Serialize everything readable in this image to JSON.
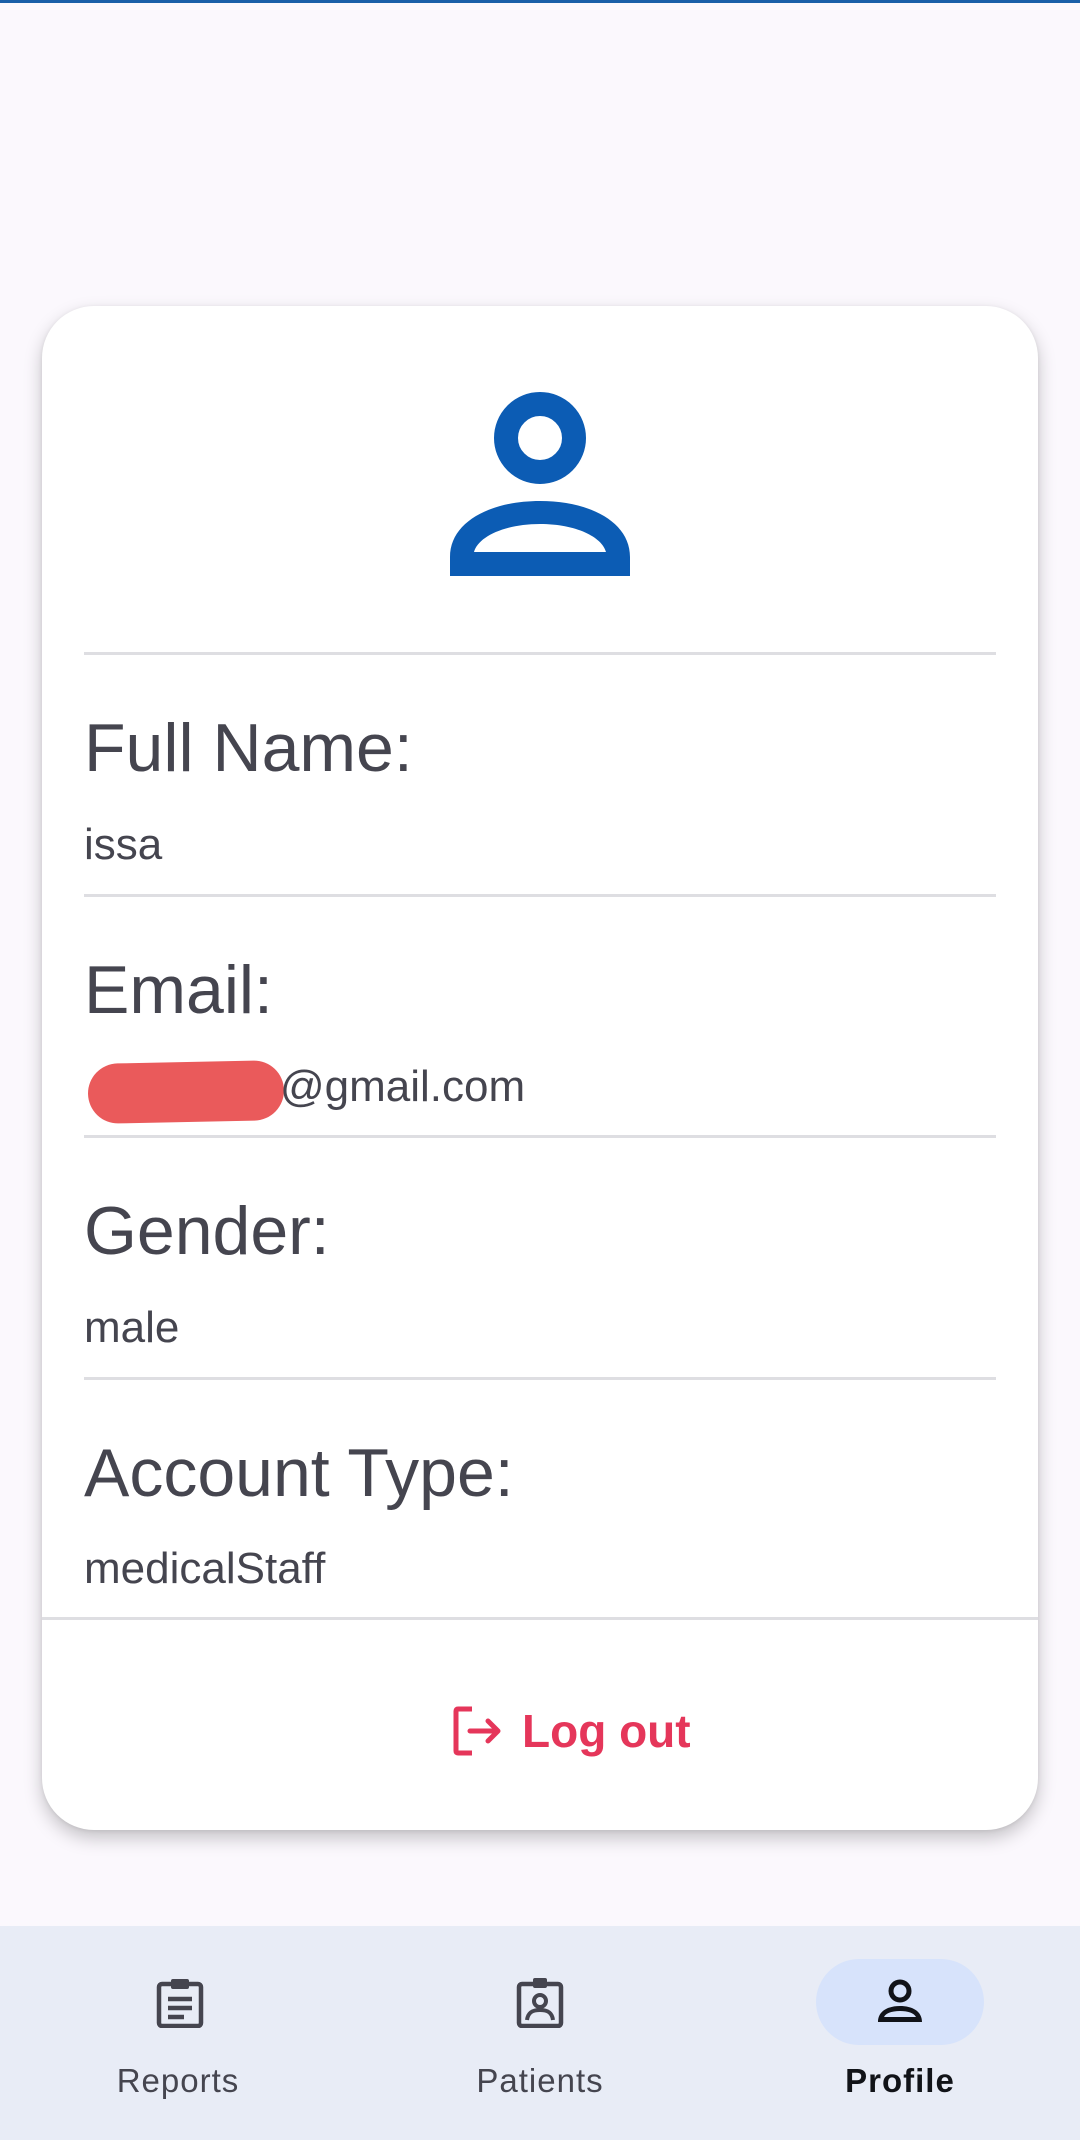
{
  "colors": {
    "accent": "#0c5cb4",
    "logout": "#e5365a",
    "background": "#fbf8fd",
    "nav_background": "#e8ecf6",
    "nav_active_pill": "#d7e3fb",
    "redaction": "#ea5a5b"
  },
  "profile": {
    "avatar_icon": "person-icon",
    "fields": [
      {
        "label": "Full Name:",
        "value": "issa"
      },
      {
        "label": "Email:",
        "value": "@gmail.com",
        "redacted_prefix": true
      },
      {
        "label": "Gender:",
        "value": "male"
      },
      {
        "label": "Account Type:",
        "value": "medicalStaff"
      }
    ],
    "logout": {
      "label": "Log out",
      "icon": "logout-icon"
    }
  },
  "nav": {
    "items": [
      {
        "label": "Reports",
        "icon": "clipboard-icon",
        "active": false
      },
      {
        "label": "Patients",
        "icon": "badge-icon",
        "active": false
      },
      {
        "label": "Profile",
        "icon": "person-icon",
        "active": true
      }
    ]
  }
}
